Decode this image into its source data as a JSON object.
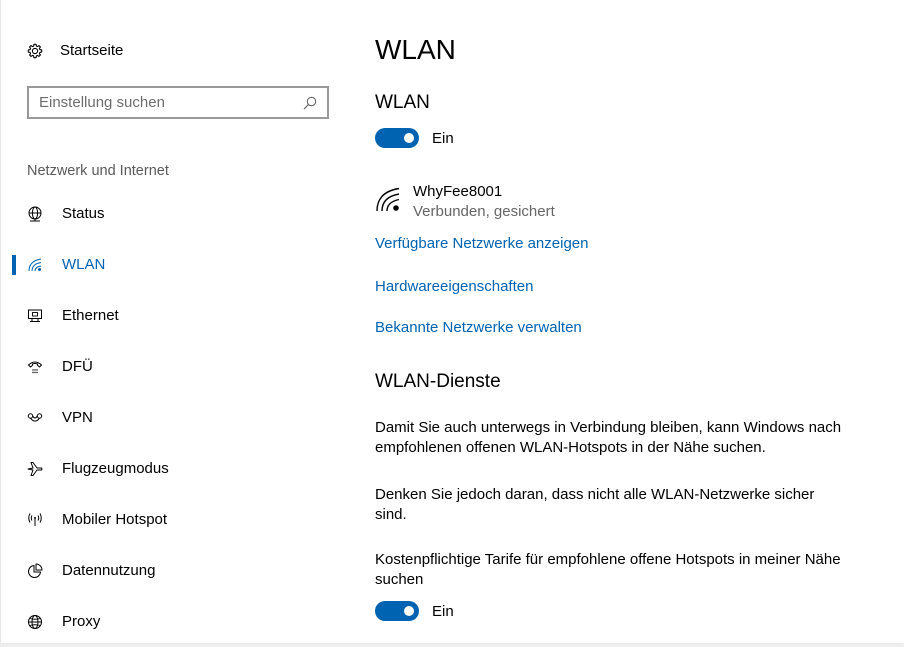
{
  "sidebar": {
    "home_label": "Startseite",
    "search_placeholder": "Einstellung suchen",
    "section_title": "Netzwerk und Internet",
    "items": [
      {
        "label": "Status",
        "icon": "globe-network-icon",
        "active": false
      },
      {
        "label": "WLAN",
        "icon": "wifi-icon",
        "active": true
      },
      {
        "label": "Ethernet",
        "icon": "ethernet-monitor-icon",
        "active": false
      },
      {
        "label": "DFÜ",
        "icon": "dialup-phone-icon",
        "active": false
      },
      {
        "label": "VPN",
        "icon": "vpn-icon",
        "active": false
      },
      {
        "label": "Flugzeugmodus",
        "icon": "airplane-icon",
        "active": false
      },
      {
        "label": "Mobiler Hotspot",
        "icon": "hotspot-icon",
        "active": false
      },
      {
        "label": "Datennutzung",
        "icon": "data-usage-icon",
        "active": false
      },
      {
        "label": "Proxy",
        "icon": "globe-icon",
        "active": false
      }
    ]
  },
  "main": {
    "page_title": "WLAN",
    "wlan_heading": "WLAN",
    "wlan_toggle_label": "Ein",
    "network": {
      "name": "WhyFee8001",
      "status": "Verbunden, gesichert"
    },
    "links": {
      "available_networks": "Verfügbare Netzwerke anzeigen",
      "hardware_properties": "Hardwareeigenschaften",
      "known_networks": "Bekannte Netzwerke verwalten"
    },
    "services_heading": "WLAN-Dienste",
    "services_para1": "Damit Sie auch unterwegs in Verbindung bleiben, kann Windows nach empfohlenen offenen WLAN-Hotspots in der Nähe suchen.",
    "services_para2": "Denken Sie jedoch daran, dass nicht alle WLAN-Netzwerke sicher sind.",
    "paid_hotspots_label": "Kostenpflichtige Tarife für empfohlene offene Hotspots in meiner Nähe suchen",
    "paid_toggle_label": "Ein"
  },
  "colors": {
    "accent": "#0063b1",
    "secondary_text": "#666666",
    "border": "#999999"
  }
}
